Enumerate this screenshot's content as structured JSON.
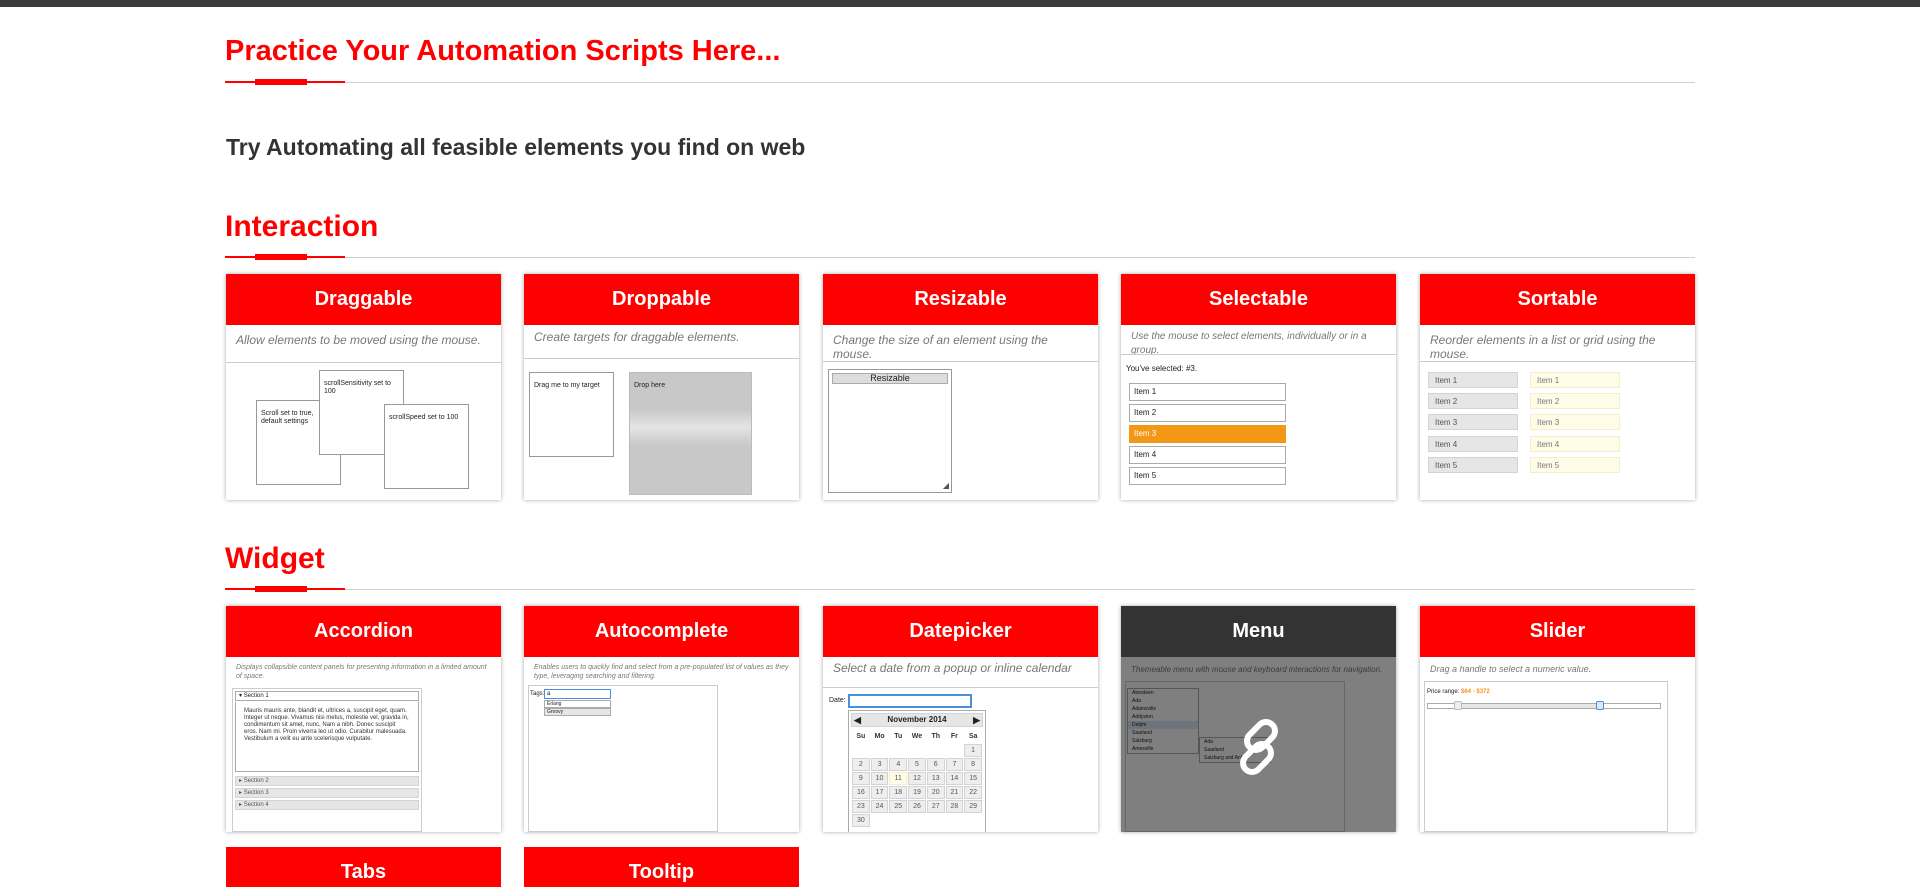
{
  "page": {
    "title": "Practice Your Automation Scripts Here...",
    "subtitle": "Try Automating all feasible elements you find on web"
  },
  "sections": {
    "interaction": "Interaction",
    "widget": "Widget"
  },
  "interaction_cards": {
    "draggable": {
      "title": "Draggable",
      "desc": "Allow elements to be moved using the mouse.",
      "box1": "Scroll set to true, default settings",
      "box2": "scrollSensitivity set to 100",
      "box3": "scrollSpeed set to 100"
    },
    "droppable": {
      "title": "Droppable",
      "desc": "Create targets for draggable elements.",
      "drag": "Drag me to my target",
      "drop": "Drop here"
    },
    "resizable": {
      "title": "Resizable",
      "desc": "Change the size of an element using the mouse.",
      "box": "Resizable"
    },
    "selectable": {
      "title": "Selectable",
      "desc": "Use the mouse to select elements, individually or in a group.",
      "status": "You've selected: #3.",
      "items": [
        "Item 1",
        "Item 2",
        "Item 3",
        "Item 4",
        "Item 5"
      ]
    },
    "sortable": {
      "title": "Sortable",
      "desc": "Reorder elements in a list or grid using the mouse.",
      "items": [
        "Item 1",
        "Item 2",
        "Item 3",
        "Item 4",
        "Item 5"
      ]
    }
  },
  "widget_cards": {
    "accordion": {
      "title": "Accordion",
      "desc": "Displays collapsible content panels for presenting information in a limited amount of space.",
      "sections": [
        "Section 1",
        "Section 2",
        "Section 3",
        "Section 4"
      ],
      "body": "Mauris mauris ante, blandit et, ultrices a, suscipit eget, quam. Integer ut neque. Vivamus nisi metus, molestie vel, gravida in, condimentum sit amet, nunc. Nam a nibh. Donec suscipit eros. Nam mi. Proin viverra leo ut odio. Curabitur malesuada. Vestibulum a velit eu ante scelerisque vulputate."
    },
    "autocomplete": {
      "title": "Autocomplete",
      "desc": "Enables users to quickly find and select from a pre-populated list of values as they type, leveraging searching and filtering.",
      "label": "Tags:",
      "value": "a",
      "suggestions": [
        "Erlang",
        "Groovy"
      ]
    },
    "datepicker": {
      "title": "Datepicker",
      "desc": "Select a date from a popup or inline calendar",
      "label": "Date:",
      "month": "November 2014",
      "weekdays": [
        "Su",
        "Mo",
        "Tu",
        "We",
        "Th",
        "Fr",
        "Sa"
      ],
      "weeks": [
        [
          "",
          "",
          "",
          "",
          "",
          "",
          "1"
        ],
        [
          "2",
          "3",
          "4",
          "5",
          "6",
          "7",
          "8"
        ],
        [
          "9",
          "10",
          "11",
          "12",
          "13",
          "14",
          "15"
        ],
        [
          "16",
          "17",
          "18",
          "19",
          "20",
          "21",
          "22"
        ],
        [
          "23",
          "24",
          "25",
          "26",
          "27",
          "28",
          "29"
        ],
        [
          "30",
          "",
          "",
          "",
          "",
          "",
          ""
        ]
      ]
    },
    "menu": {
      "title": "Menu",
      "desc": "Themeable menu with mouse and keyboard interactions for navigation.",
      "items": [
        "Aberdeen",
        "Ada",
        "Adamsville",
        "Addyston",
        "Delphi",
        "Saarland",
        "Salzburg",
        "Amesville"
      ],
      "submenu": [
        "Ada",
        "Saarland",
        "Salzburg and Anhalt"
      ]
    },
    "slider": {
      "title": "Slider",
      "desc": "Drag a handle to select a numeric value.",
      "label": "Price range:",
      "value": "$64 - $372"
    }
  },
  "more_cards": {
    "tabs": "Tabs",
    "tooltip": "Tooltip"
  },
  "colors": {
    "accent": "#ff0000",
    "dark": "#333333",
    "selected": "#f39814"
  }
}
